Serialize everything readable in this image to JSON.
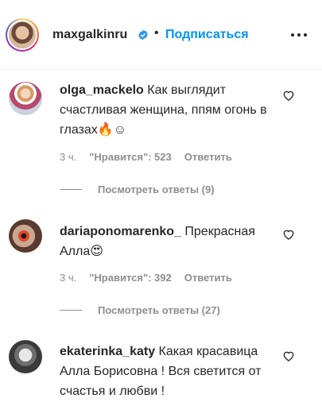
{
  "header": {
    "username": "maxgalkinru",
    "separator": "•",
    "follow_label": "Подписаться"
  },
  "comments": [
    {
      "username": "olga_mackelo",
      "text": "Как выглядит счастливая женщина, ппям огонь в глазах🔥☺",
      "time": "3 ч.",
      "likes": "\"Нравится\": 523",
      "reply": "Ответить",
      "view_replies": "Посмотреть ответы (9)"
    },
    {
      "username": "dariaponomarenko_",
      "text": "Прекрасная Алла😍",
      "time": "3 ч.",
      "likes": "\"Нравится\": 392",
      "reply": "Ответить",
      "view_replies": "Посмотреть ответы (27)"
    },
    {
      "username": "ekaterinka_katy",
      "text": "Какая красавица Алла Борисовна ! Вся светится от счастья и любви !"
    }
  ],
  "colors": {
    "accent": "#0095f6",
    "text": "#262626",
    "muted": "#8e8e8e",
    "verified": "#3897f0"
  },
  "icons": {
    "verified": "verified-badge-icon",
    "more": "more-dots-icon",
    "like": "heart-outline-icon"
  }
}
